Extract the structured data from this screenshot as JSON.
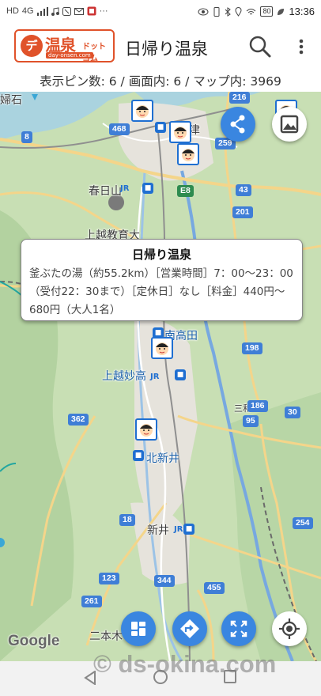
{
  "status_bar": {
    "left_icons": [
      "HD",
      "4G",
      "signal-icon",
      "music-icon",
      "nfc-icon",
      "mail-icon",
      "app-icon",
      "more-icon"
    ],
    "right_icons": [
      "eye-icon",
      "vibrate-icon",
      "bluetooth-icon",
      "location-icon",
      "wifi-icon"
    ],
    "battery": "80",
    "time": "13:36"
  },
  "app_bar": {
    "logo": {
      "disc": "デイ",
      "main": "温泉",
      "dot": "ドットコム",
      "url": "day-onsen.com"
    },
    "title": "日帰り温泉"
  },
  "info_line": "表示ピン数: 6 / 画面内: 6 / マップ内: 3969",
  "map": {
    "labels": {
      "tsu": "津",
      "kasugayama": "春日山",
      "joetsu_kyoikudai": "上越教育大",
      "minami_takada": "南高田",
      "joetsu_myoko": "上越妙高",
      "kita_arai": "北新井",
      "arai": "新井",
      "nihongi": "二本木",
      "sankai": "三和"
    },
    "shields": {
      "r8": "8",
      "r468": "468",
      "r259": "259",
      "r216": "216",
      "r43": "43",
      "e8": "E8",
      "r201": "201",
      "r198": "198",
      "r186": "186",
      "r30": "30",
      "r95": "95",
      "r362": "362",
      "r18": "18",
      "r254": "254",
      "r123": "123",
      "r261": "261",
      "r344": "344",
      "r455": "455"
    },
    "google": "Google"
  },
  "popup": {
    "title": "日帰り温泉",
    "body": "釜ぶたの湯（約55.2km）［営業時間］7：00〜23：00（受付22：30まで）［定休日］なし［料金］440円〜680円（大人1名）"
  },
  "watermark": "© ds-okina.com",
  "colors": {
    "accent": "#3a86e0",
    "logo": "#e0522a",
    "map_bg": "#c8dfb4"
  }
}
